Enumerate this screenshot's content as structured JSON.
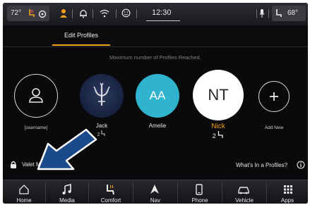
{
  "status_bar": {
    "left_temp": "72°",
    "time": "12:30",
    "right_temp": "68°"
  },
  "tabs": {
    "active": "Edit Profiles"
  },
  "notice": "Maximum number of Profiles Reached.",
  "profiles": [
    {
      "name": "[username]",
      "seat": "",
      "avatar_type": "person-icon"
    },
    {
      "name": "Jack",
      "seat": "2",
      "avatar_type": "trident-logo"
    },
    {
      "name": "Amelie",
      "seat": "",
      "avatar_type": "initials",
      "initials": "AA",
      "color": "#2fb3cf"
    },
    {
      "name": "Nick",
      "seat": "2",
      "avatar_type": "initials",
      "initials": "NT",
      "color": "#ffffff",
      "selected": true,
      "name_color": "#f2a01b"
    },
    {
      "name": "Add New",
      "seat": "",
      "avatar_type": "plus-icon"
    }
  ],
  "valet_mode": {
    "label": "Valet Mode"
  },
  "whats_in_profile": {
    "label": "What's In a Profiles?"
  },
  "nav": [
    {
      "label": "Home",
      "icon": "home-icon"
    },
    {
      "label": "Media",
      "icon": "music-note-icon"
    },
    {
      "label": "Comfort",
      "icon": "seat-icon"
    },
    {
      "label": "Nav",
      "icon": "navigation-arrow-icon"
    },
    {
      "label": "Phone",
      "icon": "phone-icon"
    },
    {
      "label": "Vehicle",
      "icon": "car-icon"
    },
    {
      "label": "Apps",
      "icon": "grid-icon"
    }
  ],
  "colors": {
    "accent": "#f2a01b",
    "background": "#0a0a0c",
    "amelie": "#2fb3cf"
  }
}
